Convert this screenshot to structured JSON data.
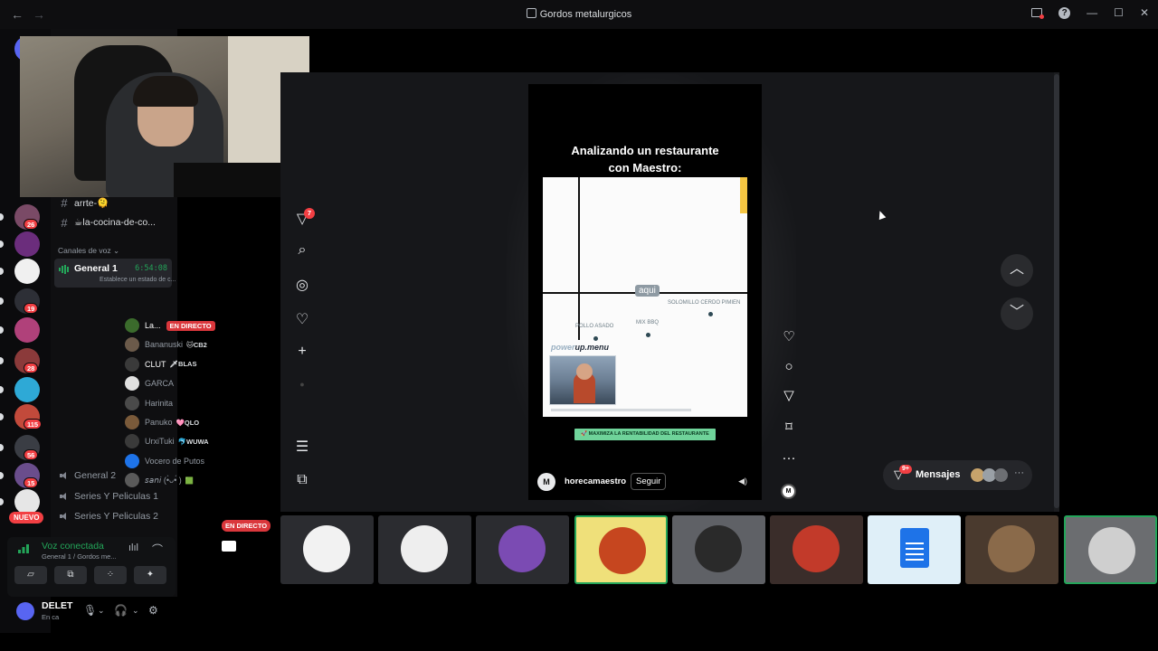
{
  "window": {
    "title": "Gordos metalurgicos"
  },
  "servers": [
    {
      "badge": "26",
      "color": "#7a4a66"
    },
    {
      "badge": "",
      "color": "#6b2d7c"
    },
    {
      "badge": "",
      "color": "#f0f0f0"
    },
    {
      "badge": "19",
      "color": "#2d2f36"
    },
    {
      "badge": "",
      "color": "#b0417a"
    },
    {
      "badge": "28",
      "color": "#8b3a3a"
    },
    {
      "badge": "",
      "color": "#2ea9d6"
    },
    {
      "badge": "115",
      "color": "#c24a3b"
    },
    {
      "badge": "56",
      "color": "#3a3d44"
    },
    {
      "badge": "15",
      "color": "#6a4d8c"
    },
    {
      "badge": "",
      "color": "#e6e6e6"
    }
  ],
  "rail_new_label": "NUEVO",
  "channels": {
    "text_channels": [
      {
        "name": "arrte-🫠"
      },
      {
        "name": "☕la-cocina-de-co..."
      }
    ],
    "voice_category": "Canales de voz ⌄",
    "active_voice": {
      "name": "General 1",
      "time": "6:54:08",
      "status": "Establece un estado de c..."
    },
    "voice_users": [
      {
        "name": "La...",
        "tag": "",
        "live": "EN DIRECTO",
        "color": "#3b6b2c"
      },
      {
        "name": "Bananuski",
        "tag": "🐱CB2",
        "live": "",
        "color": "#6b5a4a"
      },
      {
        "name": "CLUT",
        "tag": "🗡BLAS",
        "live": "",
        "color": "#3a3a3a"
      },
      {
        "name": "GARCA",
        "tag": "",
        "live": "",
        "color": "#e0e0e0"
      },
      {
        "name": "Harinita",
        "tag": "",
        "live": "",
        "color": "#4a4a4a"
      },
      {
        "name": "Panuko",
        "tag": "🩷QLO",
        "live": "",
        "color": "#7a5a3a"
      },
      {
        "name": "UrxiTuki",
        "tag": "🐬WUWA",
        "live": "",
        "color": "#3a3a3a"
      },
      {
        "name": "Vocero de Putos",
        "tag": "",
        "live": "",
        "color": "#1e73e8"
      },
      {
        "name": "𝘴𝘢𝘯𝘪 (•̀ᴗ•́ )",
        "tag": "🟩",
        "live": "",
        "color": "#5a5a5a"
      }
    ],
    "other_voice": [
      {
        "name": "General 2"
      },
      {
        "name": "Series Y Peliculas 1"
      },
      {
        "name": "Series Y Peliculas 2"
      }
    ]
  },
  "voice_panel": {
    "status": "Voz conectada",
    "location": "General 1 / Gordos me..."
  },
  "user": {
    "name": "DELET",
    "status": "En ca"
  },
  "tiktok": {
    "notification_count": "7",
    "video_title_line1": "Analizando un restaurante",
    "video_title_line2": "con Maestro:",
    "aqui": "aqui",
    "labels": {
      "pollo": "POLLO ASADO",
      "mix": "MIX BBQ",
      "solomillo": "SOLOMILLO CERDO PIMIEN"
    },
    "overlay_brand_prefix": "power",
    "overlay_brand": "up.menu",
    "cta": "🚀 MAXIMIZA LA RENTABILIDAD DEL RESTAURANTE",
    "account_logo": "M",
    "username": "horecamaestro",
    "follow": "Seguir",
    "messages_label": "Mensajes",
    "messages_badge": "9+"
  },
  "stream_tile_live": "EN DIRECTO",
  "tiles": [
    {
      "bg": "#2b2c30",
      "face": "#f2f2f2",
      "selected": false
    },
    {
      "bg": "#2b2c30",
      "face": "#eeeeee",
      "selected": false
    },
    {
      "bg": "#2b2c30",
      "face": "#7b4bb3",
      "selected": false
    },
    {
      "bg": "#efe07a",
      "face": "#c6461f",
      "selected": true
    },
    {
      "bg": "#5f6166",
      "face": "#2a2a2a",
      "selected": false
    },
    {
      "bg": "#3a2d2a",
      "face": "#c23a2a",
      "selected": false
    },
    {
      "bg": "#dfeff8",
      "face": "",
      "selected": false
    },
    {
      "bg": "#4a3a2e",
      "face": "#8a6a4a",
      "selected": false
    },
    {
      "bg": "#6b6d70",
      "face": "#cfcfcf",
      "selected": true
    }
  ]
}
